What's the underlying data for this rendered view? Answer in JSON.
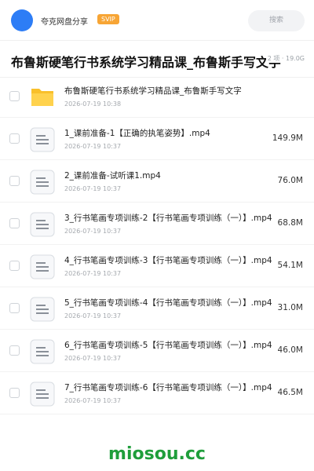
{
  "header": {
    "share_name": "夸克网盘分享",
    "badge": "SVIP",
    "search_placeholder": "搜索"
  },
  "title_bar": {
    "title": "布鲁斯硬笔行书系统学习精品课_布鲁斯手写文字",
    "meta": "2 项 · 19.0G"
  },
  "colors": {
    "accent": "#2d7df6",
    "svip": "#f7a535",
    "folder": "#f9c02b",
    "watermark": "#1f9e3b"
  },
  "files": [
    {
      "name": "布鲁斯硬笔行书系统学习精品课_布鲁斯手写文字",
      "date": "2026-07-19 10:38",
      "size": "",
      "icon": "folder-icon"
    },
    {
      "name": "1_课前准备-1【正确的执笔姿势】.mp4",
      "date": "2026-07-19 10:37",
      "size": "149.9M",
      "icon": "file-icon"
    },
    {
      "name": "2_课前准备-试听课1.mp4",
      "date": "2026-07-19 10:37",
      "size": "76.0M",
      "icon": "file-icon"
    },
    {
      "name": "3_行书笔画专项训练-2【行书笔画专项训练（一）】.mp4",
      "date": "2026-07-19 10:37",
      "size": "68.8M",
      "icon": "file-icon"
    },
    {
      "name": "4_行书笔画专项训练-3【行书笔画专项训练（一）】.mp4",
      "date": "2026-07-19 10:37",
      "size": "54.1M",
      "icon": "file-icon"
    },
    {
      "name": "5_行书笔画专项训练-4【行书笔画专项训练（一）】.mp4",
      "date": "2026-07-19 10:37",
      "size": "31.0M",
      "icon": "file-icon"
    },
    {
      "name": "6_行书笔画专项训练-5【行书笔画专项训练（一）】.mp4",
      "date": "2026-07-19 10:37",
      "size": "46.0M",
      "icon": "file-icon"
    },
    {
      "name": "7_行书笔画专项训练-6【行书笔画专项训练（一）】.mp4",
      "date": "2026-07-19 10:37",
      "size": "46.5M",
      "icon": "file-icon"
    }
  ],
  "watermark": "miosou.cc"
}
